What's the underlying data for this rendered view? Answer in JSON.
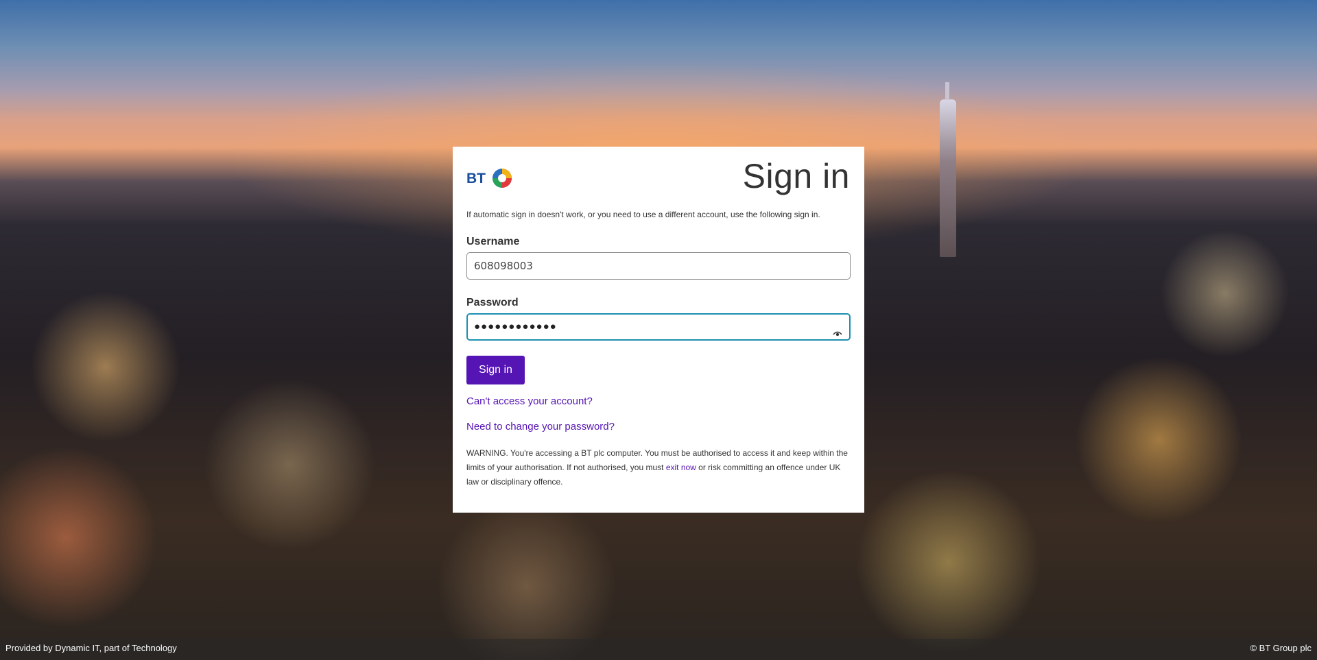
{
  "background": {
    "description_icon": "london-skyline-photo"
  },
  "card": {
    "brand": "BT",
    "title": "Sign in",
    "intro": "If automatic sign in doesn't work, or you need to use a different account, use the following sign in.",
    "username": {
      "label": "Username",
      "value": "608098003"
    },
    "password": {
      "label": "Password",
      "value": "●●●●●●●●●●●●",
      "reveal_icon": "eye-icon"
    },
    "sign_in_button": "Sign in",
    "links": {
      "cant_access": "Can't access your account?",
      "change_password": "Need to change your password?"
    },
    "warning": {
      "before": "WARNING. You're accessing a BT plc computer. You must be authorised to access it and keep within the limits of your authorisation. If not authorised, you must ",
      "link": "exit now",
      "after": " or risk committing an offence under UK law or disciplinary offence."
    }
  },
  "footer": {
    "left": "Provided by Dynamic IT, part of Technology",
    "right": "© BT Group plc"
  },
  "colors": {
    "accent": "#5514b4",
    "focus_border": "#1d8fb0"
  }
}
